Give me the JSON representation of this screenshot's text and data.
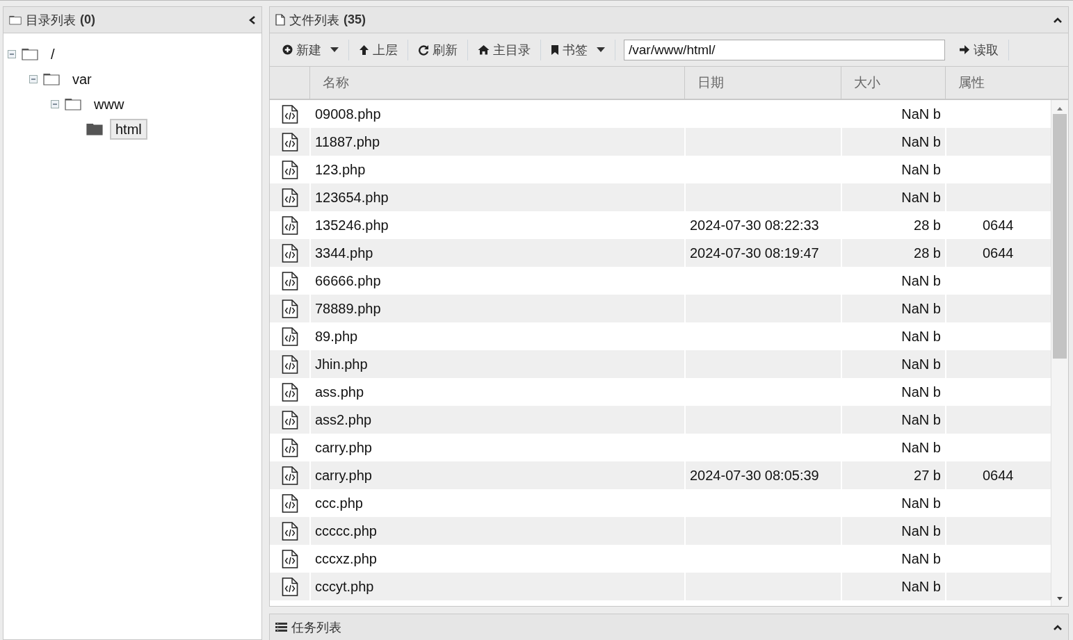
{
  "directory_panel": {
    "title": "目录列表",
    "count": "(0)",
    "collapsed": false
  },
  "tree": [
    {
      "label": "/",
      "expanded": true,
      "selected": false,
      "children": [
        {
          "label": "var",
          "expanded": true,
          "selected": false,
          "children": [
            {
              "label": "www",
              "expanded": true,
              "selected": false,
              "children": [
                {
                  "label": "html",
                  "selected": true
                }
              ]
            }
          ]
        }
      ]
    }
  ],
  "file_panel": {
    "title": "文件列表",
    "count": "(35)"
  },
  "toolbar": [
    {
      "kind": "new",
      "label": "新建",
      "dropdown": true
    },
    {
      "kind": "up",
      "label": "上层",
      "dropdown": false
    },
    {
      "kind": "refresh",
      "label": "刷新",
      "dropdown": false
    },
    {
      "kind": "home",
      "label": "主目录",
      "dropdown": false
    },
    {
      "kind": "bookmark",
      "label": "书签",
      "dropdown": true
    }
  ],
  "path_field": {
    "value": "/var/www/html/"
  },
  "read_button": {
    "label": "读取"
  },
  "table": {
    "columns": [
      "名称",
      "日期",
      "大小",
      "属性"
    ],
    "rows": [
      {
        "name": "09008.php",
        "date": "",
        "size": "NaN b",
        "attr": ""
      },
      {
        "name": "11887.php",
        "date": "",
        "size": "NaN b",
        "attr": ""
      },
      {
        "name": "123.php",
        "date": "",
        "size": "NaN b",
        "attr": ""
      },
      {
        "name": "123654.php",
        "date": "",
        "size": "NaN b",
        "attr": ""
      },
      {
        "name": "135246.php",
        "date": "2024-07-30 08:22:33",
        "size": "28 b",
        "attr": "0644"
      },
      {
        "name": "3344.php",
        "date": "2024-07-30 08:19:47",
        "size": "28 b",
        "attr": "0644"
      },
      {
        "name": "66666.php",
        "date": "",
        "size": "NaN b",
        "attr": ""
      },
      {
        "name": "78889.php",
        "date": "",
        "size": "NaN b",
        "attr": ""
      },
      {
        "name": "89.php",
        "date": "",
        "size": "NaN b",
        "attr": ""
      },
      {
        "name": "Jhin.php",
        "date": "",
        "size": "NaN b",
        "attr": ""
      },
      {
        "name": "ass.php",
        "date": "",
        "size": "NaN b",
        "attr": ""
      },
      {
        "name": "ass2.php",
        "date": "",
        "size": "NaN b",
        "attr": ""
      },
      {
        "name": "carry.php",
        "date": "",
        "size": "NaN b",
        "attr": ""
      },
      {
        "name": "carry.php",
        "date": "2024-07-30 08:05:39",
        "size": "27 b",
        "attr": "0644"
      },
      {
        "name": "ccc.php",
        "date": "",
        "size": "NaN b",
        "attr": ""
      },
      {
        "name": "ccccc.php",
        "date": "",
        "size": "NaN b",
        "attr": ""
      },
      {
        "name": "cccxz.php",
        "date": "",
        "size": "NaN b",
        "attr": ""
      },
      {
        "name": "cccyt.php",
        "date": "",
        "size": "NaN b",
        "attr": ""
      }
    ]
  },
  "task_panel": {
    "title": "任务列表"
  }
}
